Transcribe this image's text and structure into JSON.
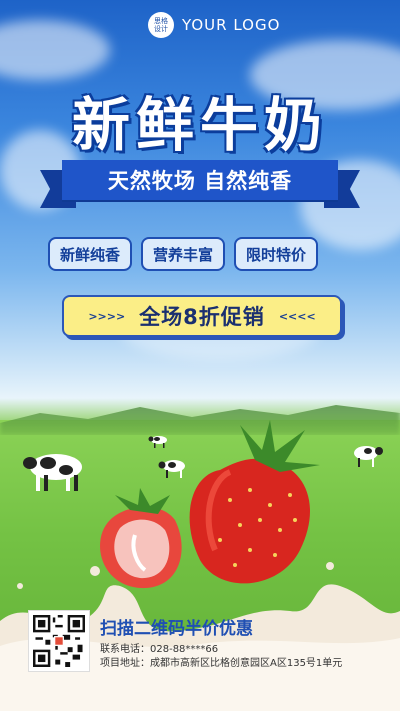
{
  "logo": {
    "badge": "思格\n设计",
    "text": "YOUR LOGO"
  },
  "title": "新鲜牛奶",
  "ribbon": "天然牧场 自然纯香",
  "tags": [
    "新鲜纯香",
    "营养丰富",
    "限时特价"
  ],
  "promo": {
    "left_arrows": ">>>>",
    "text": "全场8折促销",
    "right_arrows": "<<<<"
  },
  "footer": {
    "title": "扫描二维码半价优惠",
    "phone": "联系电话：028-88****66",
    "address": "项目地址：成都市高新区比格创意园区A区135号1单元"
  },
  "colors": {
    "primary": "#1f55c9",
    "promo_bg": "#fbee87",
    "tag_bg": "#dcebfb"
  }
}
